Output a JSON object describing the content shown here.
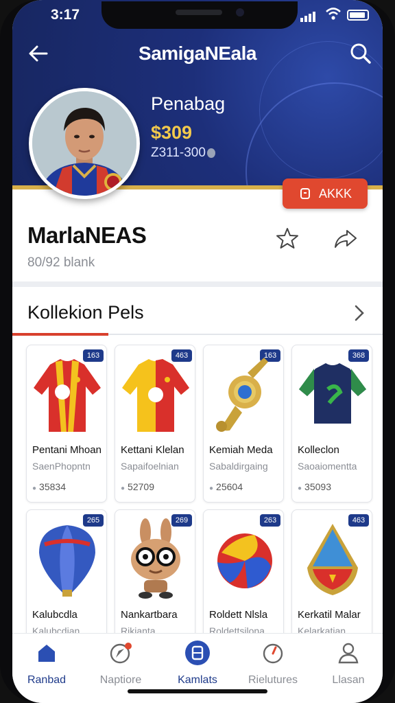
{
  "status_bar": {
    "time": "3:17"
  },
  "header": {
    "title": "SamigaNEala",
    "hero_name": "Penabag",
    "hero_price": "$309",
    "hero_sub": "Z311-300",
    "action_label": "AKKK"
  },
  "profile": {
    "name": "MarlaNEAS",
    "subtitle": "80/92 blank"
  },
  "collection": {
    "title": "Kollekion Pels",
    "items": [
      {
        "badge": "163",
        "title": "Pentani Mhoan",
        "desc": "SaenPhopntn",
        "price": "35834"
      },
      {
        "badge": "463",
        "title": "Kettani Klelan",
        "desc": "Sapaifoelnian",
        "price": "52709"
      },
      {
        "badge": "163",
        "title": "Kemiah Meda",
        "desc": "Sabaldirgaing",
        "price": "25604"
      },
      {
        "badge": "368",
        "title": "Kolleclon",
        "desc": "Saoaiomentta",
        "price": "35093"
      },
      {
        "badge": "265",
        "title": "Kalubcdla",
        "desc": "Kalubcdian",
        "price": ""
      },
      {
        "badge": "269",
        "title": "Nankartbara",
        "desc": "Rikianta",
        "price": ""
      },
      {
        "badge": "263",
        "title": "Roldett Nlsla",
        "desc": "Roldettsilona",
        "price": ""
      },
      {
        "badge": "463",
        "title": "Kerkatil Malar",
        "desc": "Kelarkatian",
        "price": ""
      }
    ]
  },
  "tabbar": {
    "tabs": [
      {
        "label": "Ranbad",
        "icon": "home-icon"
      },
      {
        "label": "Naptiore",
        "icon": "explore-icon"
      },
      {
        "label": "Kamlats",
        "icon": "collection-icon"
      },
      {
        "label": "Rielutures",
        "icon": "gauge-icon"
      },
      {
        "label": "Llasan",
        "icon": "profile-icon"
      }
    ],
    "active_index": 2
  },
  "colors": {
    "header_blue": "#1d2f7a",
    "accent_red": "#e0482f",
    "gold": "#f2c94c",
    "badge_blue": "#1e3a8a"
  }
}
